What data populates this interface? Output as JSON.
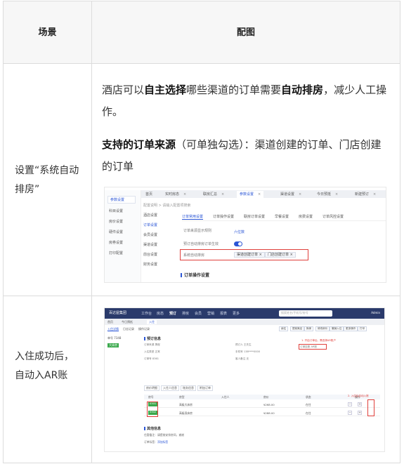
{
  "table": {
    "header": {
      "scene": "场景",
      "config": "配图"
    },
    "row1": {
      "scene": "设置“系统自动排房”",
      "p1_pre": "酒店可以",
      "p1_b1": "自主选择",
      "p1_mid": "哪些渠道的订单需要",
      "p1_b2": "自动排房",
      "p1_post": "，减少人工操作。",
      "p2_b": "支持的订单来源",
      "p2_post": "（可单独勾选）：渠道创建的订单、门店创建的订单"
    },
    "row2": {
      "scene": "入住成功后，自动入AR账"
    }
  },
  "shot1": {
    "tabs": [
      "首页",
      "实时房态",
      "联房汇总",
      "参数设置",
      "渠道设置",
      "今日预抵",
      "新建预订"
    ],
    "side": [
      "参数设置",
      "科目设置",
      "房价设置",
      "硬件设置",
      "房券设置",
      "打印配置"
    ],
    "crumb": "配置说明 > 请输入配置项搜索",
    "menu": [
      "酒店设置",
      "订单设置",
      "会员设置",
      "渠道设置",
      "前台设置",
      "财务设置"
    ],
    "subtabs": [
      "订单常用设置",
      "订单操作设置",
      "联房订单设置",
      "早餐设置",
      "房费设置",
      "订单风控设置"
    ],
    "rows": [
      {
        "label": "订单来源显示规则",
        "value": "六位数"
      },
      {
        "label": "预订自动排房订单生效",
        "value": ""
      },
      {
        "label": "系统自动排房",
        "value": ""
      }
    ],
    "chips": [
      "渠道创建订单 ×",
      "门店创建订单 ×"
    ],
    "section": "订单操作设置"
  },
  "shot2": {
    "brand": "百达屋集团",
    "nav": [
      "工作台",
      "房态",
      "预订",
      "排房",
      "会员",
      "营销",
      "报表",
      "更多"
    ],
    "search": "搜索姓名/手机号/房号",
    "user": "Admin",
    "tabs": [
      "首页",
      "今日预抵",
      "入住"
    ],
    "subnav": [
      "入住详情",
      "日志记录",
      "操作记录"
    ],
    "buttons": [
      "续住",
      "提前离店",
      "换房",
      "修改房价",
      "撤销入住",
      "更多操作",
      "打印"
    ],
    "left": [
      "单号 7348",
      "大床房"
    ],
    "title1": "预订信息",
    "title2": "其他信息",
    "fields": [
      "订单来源 携程",
      "入住类型 正常",
      "订单号 8361",
      "预订人 王先生",
      "手机号 138****0000",
      "客人备注 无"
    ],
    "note1": "1. 开启订单后，需选择AR账户",
    "note2": "2. 入住后自动入账",
    "ar_label": "订单挂账 AR账",
    "rowtabs": [
      "房价明细",
      "入住人信息",
      "账务信息",
      "附加订单"
    ],
    "th": [
      "房号",
      "房型",
      "入住人",
      "房价",
      "状态",
      "操作"
    ],
    "rows": [
      {
        "room": "0301",
        "type": "高级大床房",
        "price": "¥268.00",
        "status": "在住"
      },
      {
        "room": "0302",
        "type": "高级双床房",
        "price": "¥288.00",
        "status": "在住"
      }
    ],
    "foot1": "住客备注：请提前安排房间，谢谢",
    "foot2": "订单标签：",
    "foot2_link": "添加标签"
  }
}
